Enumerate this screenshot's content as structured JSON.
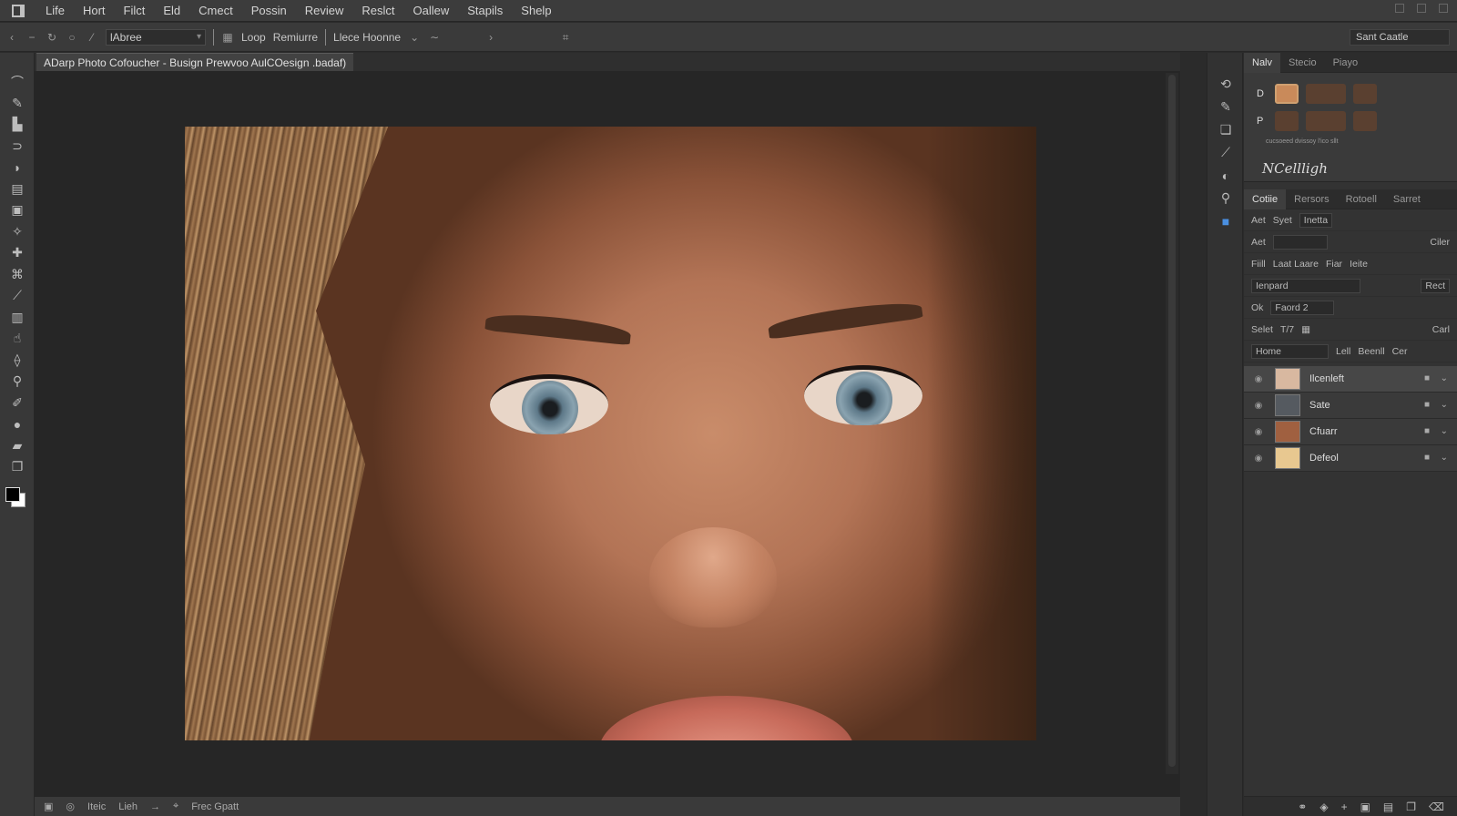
{
  "menu": [
    "Life",
    "Hort",
    "Filct",
    "Eld",
    "Cmect",
    "Possin",
    "Review",
    "Reslct",
    "Oallew",
    "Stapils",
    "Shelp"
  ],
  "options": {
    "preset": "lAbree",
    "seg1": "Loop",
    "seg2": "Remiurre",
    "seg3": "Llece Hoonne",
    "workspace": "Sant Caatle"
  },
  "document": {
    "tab_title": "ADarp Photo Cofoucher - Busign Prewvoo  AulCOesign .badaf)"
  },
  "statusbar": [
    "Iteic",
    "Lieh",
    "Frec Gpatt"
  ],
  "brush_panel": {
    "tabs": [
      "Nalv",
      "Stecio",
      "Piayo"
    ],
    "row_labels": [
      "D",
      "P"
    ],
    "brush_name": "NCellligh",
    "caption": "cucsoeed dvissoy l'ico sllt"
  },
  "properties": {
    "tabs": [
      "Cotiie",
      "Rersors",
      "Rotoell",
      "Sarret"
    ],
    "row1": [
      "Aet",
      "Syet",
      "Inetta"
    ],
    "row2": [
      "Aet",
      "Ciler"
    ],
    "row3": [
      "Fiill",
      "Laat Laare",
      "Fiar",
      "Ieite"
    ],
    "blend_mode": "Ienpard",
    "blend_right": "Rect",
    "opacity_label": "Ok",
    "opacity_value": "Faord 2",
    "row6": [
      "Selet",
      "T/7",
      "Carl"
    ],
    "group_select": "Home",
    "group_right": [
      "Lell",
      "Beenll",
      "Cer"
    ]
  },
  "layers": [
    {
      "name": "Ilcenleft",
      "active": true,
      "color": "#d8b8a0"
    },
    {
      "name": "Sate",
      "active": false,
      "color": "#555a60"
    },
    {
      "name": "Cfuarr",
      "active": false,
      "color": "#a06040"
    },
    {
      "name": "Defeol",
      "active": false,
      "color": "#e8c890"
    }
  ]
}
